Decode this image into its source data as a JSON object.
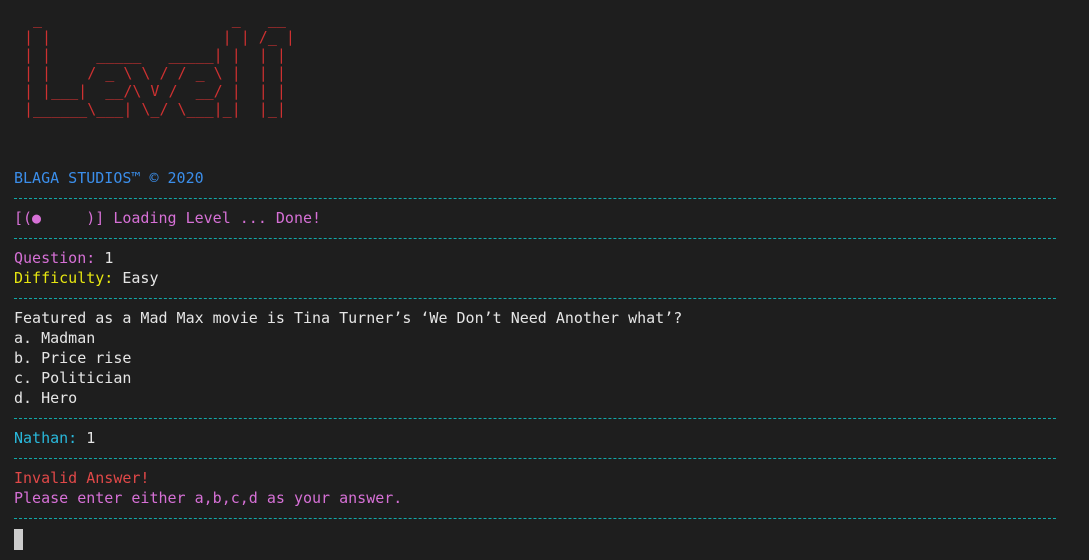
{
  "banner": {
    "ascii_art": " _                     _   __\n| |                   | | /_ |\n| |     _____   _____| |  | |\n| |    / _ \\ \\ / / _ \\ |  | |\n| |___|  __/\\ V /  __/ |  | |\n|______\\___| \\_/ \\___|_|  |_|",
    "studio_credit": "BLAGA STUDIOS™ © 2020"
  },
  "loading": {
    "text": "[(●     )] Loading Level ... Done!"
  },
  "question_info": {
    "question_label": "Question:",
    "question_number": "1",
    "difficulty_label": "Difficulty:",
    "difficulty_value": "Easy"
  },
  "question": {
    "text": "Featured as a Mad Max movie is Tina Turner’s ‘We Don’t Need Another what’?",
    "options": [
      "a. Madman",
      "b. Price rise",
      "c. Politician",
      "d. Hero"
    ]
  },
  "player": {
    "name_label": "Nathan:",
    "answer": "1"
  },
  "error": {
    "title": "Invalid Answer!",
    "message": "Please enter either a,b,c,d as your answer."
  },
  "colors": {
    "background": "#1e1e1e",
    "ascii_red": "#cd3131",
    "blue": "#3b8eea",
    "magenta": "#d670d6",
    "yellow": "#e5e510",
    "red": "#e04848",
    "separator_teal": "#11a8a8",
    "text": "#cccccc"
  }
}
